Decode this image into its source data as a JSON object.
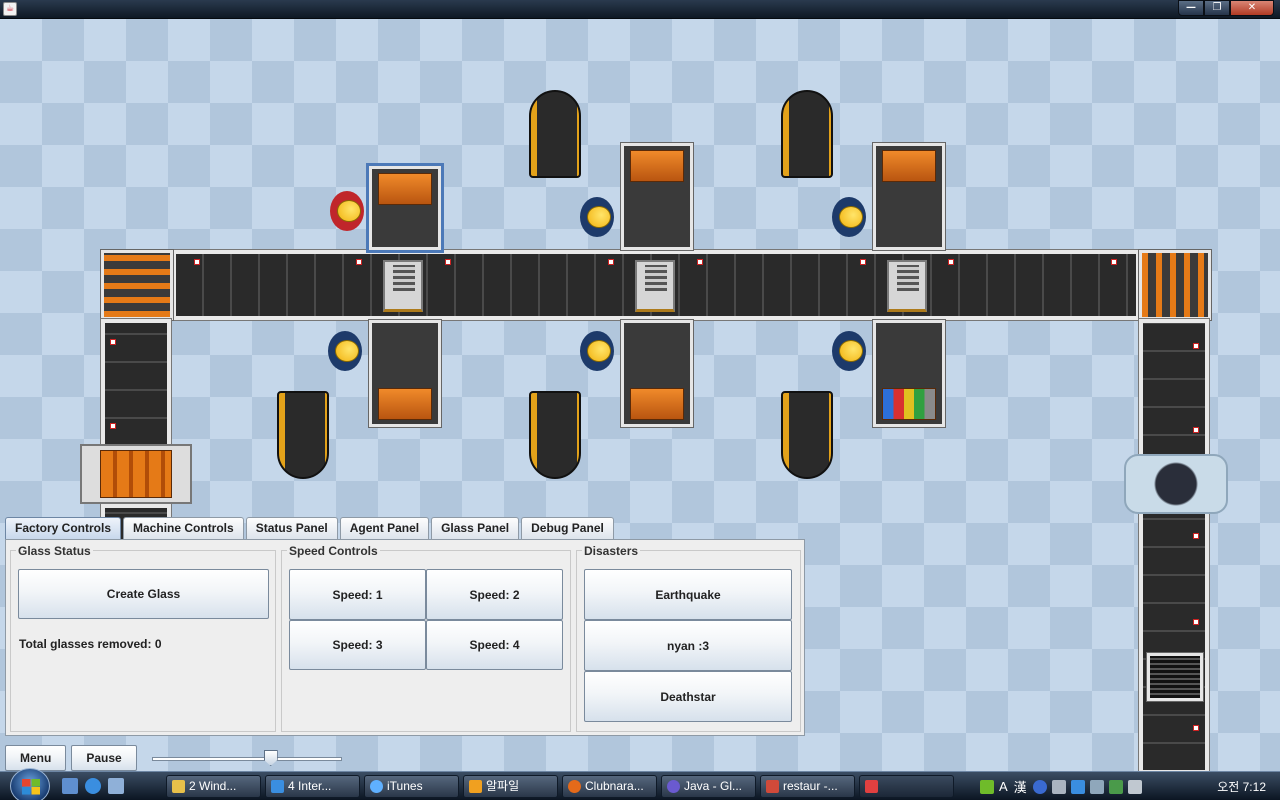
{
  "window": {
    "title": ""
  },
  "window_buttons": {
    "minimize": "—",
    "maximize": "❐",
    "close": "✕"
  },
  "tabs": [
    {
      "label": "Factory Controls",
      "active": true
    },
    {
      "label": "Machine Controls",
      "active": false
    },
    {
      "label": "Status Panel",
      "active": false
    },
    {
      "label": "Agent Panel",
      "active": false
    },
    {
      "label": "Glass Panel",
      "active": false
    },
    {
      "label": "Debug Panel",
      "active": false
    }
  ],
  "glass_status": {
    "title": "Glass Status",
    "create_button": "Create Glass",
    "removed_label": "Total glasses removed: 0"
  },
  "speed_controls": {
    "title": "Speed Controls",
    "buttons": [
      "Speed: 1",
      "Speed: 2",
      "Speed: 3",
      "Speed: 4"
    ]
  },
  "disasters": {
    "title": "Disasters",
    "buttons": [
      "Earthquake",
      "nyan :3",
      "Deathstar"
    ]
  },
  "bottom_controls": {
    "menu": "Menu",
    "pause": "Pause"
  },
  "taskbar": {
    "tasks": [
      {
        "label": "2 Wind...",
        "icon": "folder-icon",
        "color": "#e8c04a"
      },
      {
        "label": "4 Inter...",
        "icon": "internet-explorer-icon",
        "color": "#3a8ee0"
      },
      {
        "label": "iTunes",
        "icon": "itunes-icon",
        "color": "#5fb0ff"
      },
      {
        "label": "알파일",
        "icon": "alzip-icon",
        "color": "#f0a020"
      },
      {
        "label": "Clubnara...",
        "icon": "firefox-icon",
        "color": "#e46a1a"
      },
      {
        "label": "Java - Gl...",
        "icon": "eclipse-icon",
        "color": "#6a5ad0"
      },
      {
        "label": "restaur -...",
        "icon": "paint-icon",
        "color": "#d04a3a"
      },
      {
        "label": "",
        "icon": "java-icon",
        "color": "#e04040"
      }
    ],
    "tray_text": [
      "A",
      "漢"
    ],
    "clock": "오전 7:12"
  },
  "colors": {
    "floor_light": "#c5d7ea",
    "floor_dark": "#b1c6dc",
    "conveyor": "#2e2e2e",
    "machine_orange": "#e57a17",
    "bin_yellow": "#e3a21a",
    "worker_blue": "#1d3a6a",
    "worker_red": "#c0262b",
    "worker_head": "#f2b10d",
    "tab_active": "#c8d8ec"
  }
}
